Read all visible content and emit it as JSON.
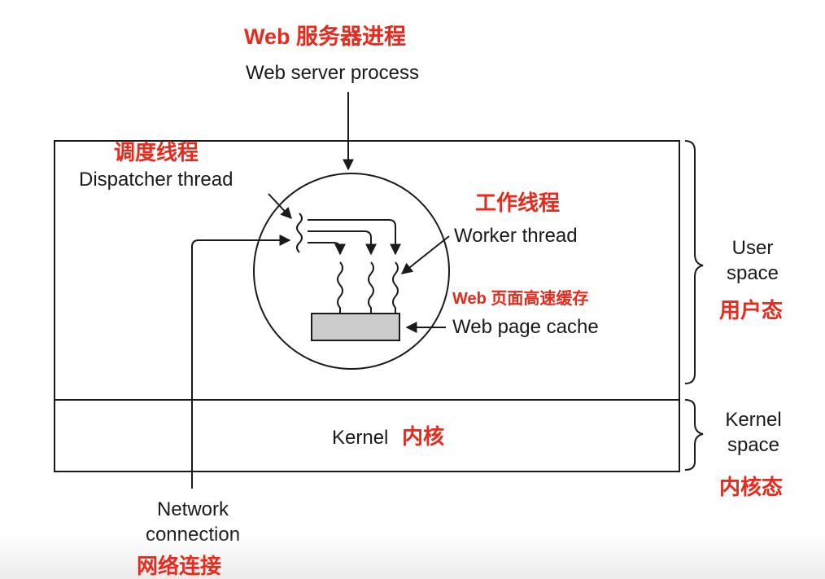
{
  "colors": {
    "annotation_red": "#e8291c",
    "line": "#1a1a1a",
    "cache_fill": "#cccccc"
  },
  "labels": {
    "web_server_cn": "Web 服务器进程",
    "web_server_en": "Web server process",
    "dispatcher_cn": "调度线程",
    "dispatcher_en": "Dispatcher thread",
    "worker_cn": "工作线程",
    "worker_en": "Worker thread",
    "cache_cn": "Web 页面高速缓存",
    "cache_en": "Web page cache",
    "user_space_line1": "User",
    "user_space_line2": "space",
    "user_space_cn": "用户态",
    "kernel_text": "Kernel",
    "kernel_cn": "内核",
    "kernel_space_line1": "Kernel",
    "kernel_space_line2": "space",
    "kernel_space_cn": "内核态",
    "network_line1": "Network",
    "network_line2": "connection",
    "network_cn": "网络连接"
  }
}
